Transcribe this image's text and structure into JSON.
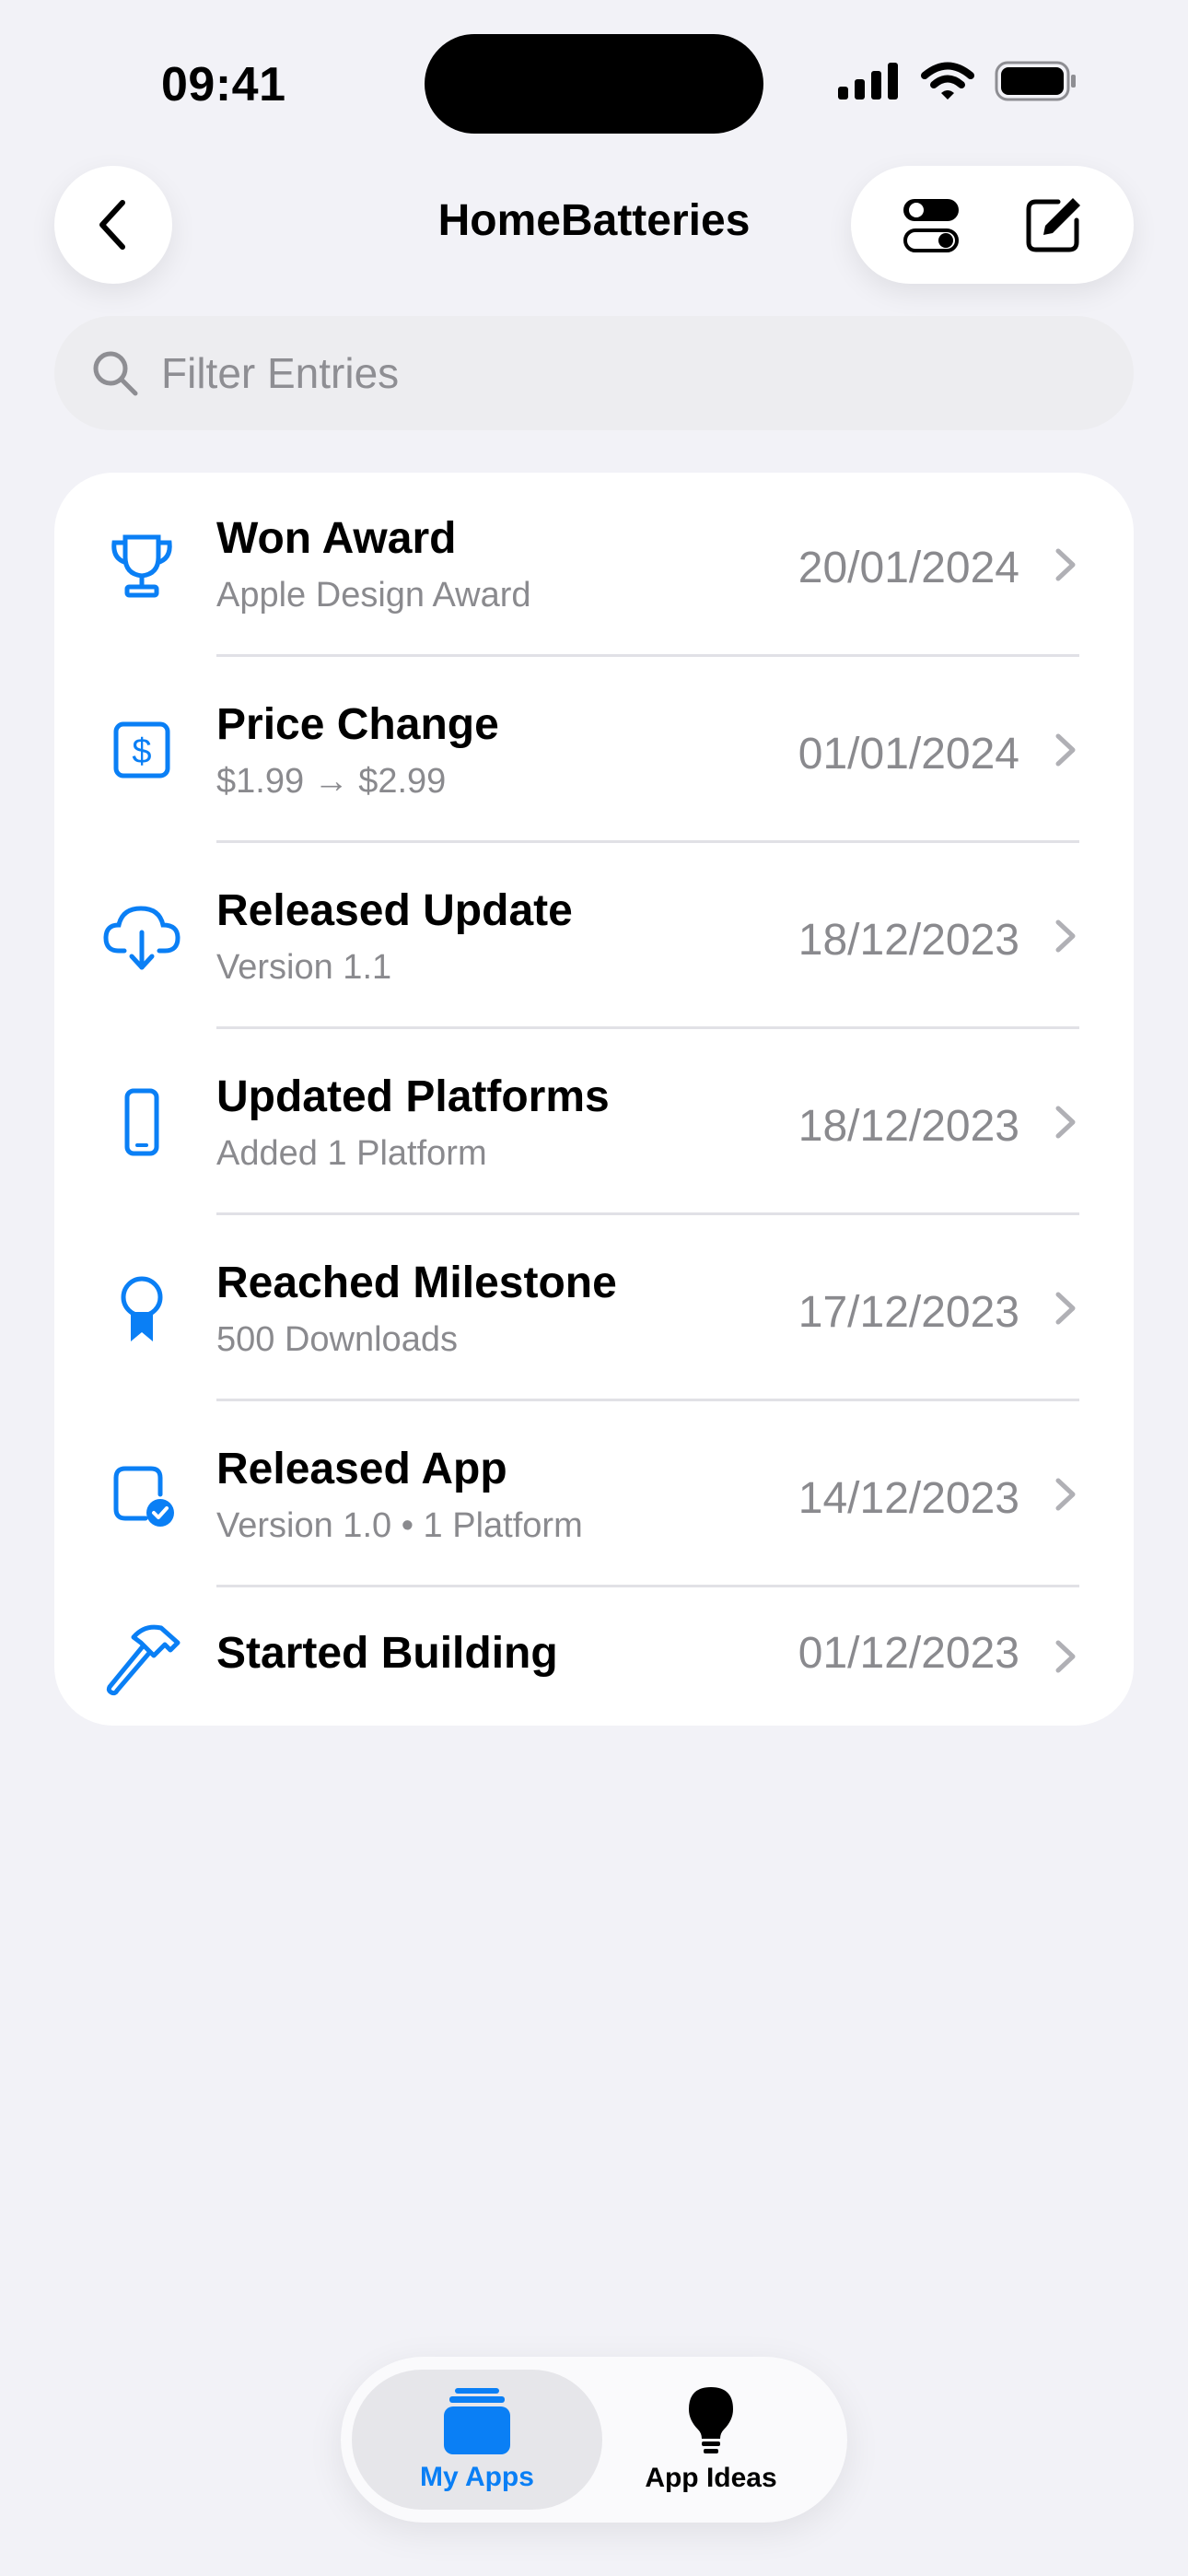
{
  "status_bar": {
    "time": "09:41"
  },
  "nav": {
    "title": "HomeBatteries"
  },
  "search": {
    "placeholder": "Filter Entries"
  },
  "entries": [
    {
      "icon": "trophy-icon",
      "title": "Won Award",
      "subtitle": "Apple Design Award",
      "date": "20/01/2024"
    },
    {
      "icon": "dollar-sign-icon",
      "title": "Price Change",
      "subtitle": "$1.99 → $2.99",
      "date": "01/01/2024"
    },
    {
      "icon": "cloud-download-icon",
      "title": "Released Update",
      "subtitle": "Version 1.1",
      "date": "18/12/2023"
    },
    {
      "icon": "iphone-icon",
      "title": "Updated Platforms",
      "subtitle": "Added 1 Platform",
      "date": "18/12/2023"
    },
    {
      "icon": "award-ribbon-icon",
      "title": "Reached Milestone",
      "subtitle": "500 Downloads",
      "date": "17/12/2023"
    },
    {
      "icon": "app-checkmark-icon",
      "title": "Released App",
      "subtitle": "Version 1.0 • 1 Platform",
      "date": "14/12/2023"
    },
    {
      "icon": "hammer-icon",
      "title": "Started Building",
      "subtitle": "",
      "date": "01/12/2023"
    }
  ],
  "tabs": [
    {
      "icon": "stack-icon",
      "label": "My Apps",
      "active": true
    },
    {
      "icon": "lightbulb-icon",
      "label": "App Ideas",
      "active": false
    }
  ],
  "colors": {
    "accent": "#0a7ff5",
    "background": "#f2f2f7",
    "secondary_text": "#8a8a8e"
  }
}
